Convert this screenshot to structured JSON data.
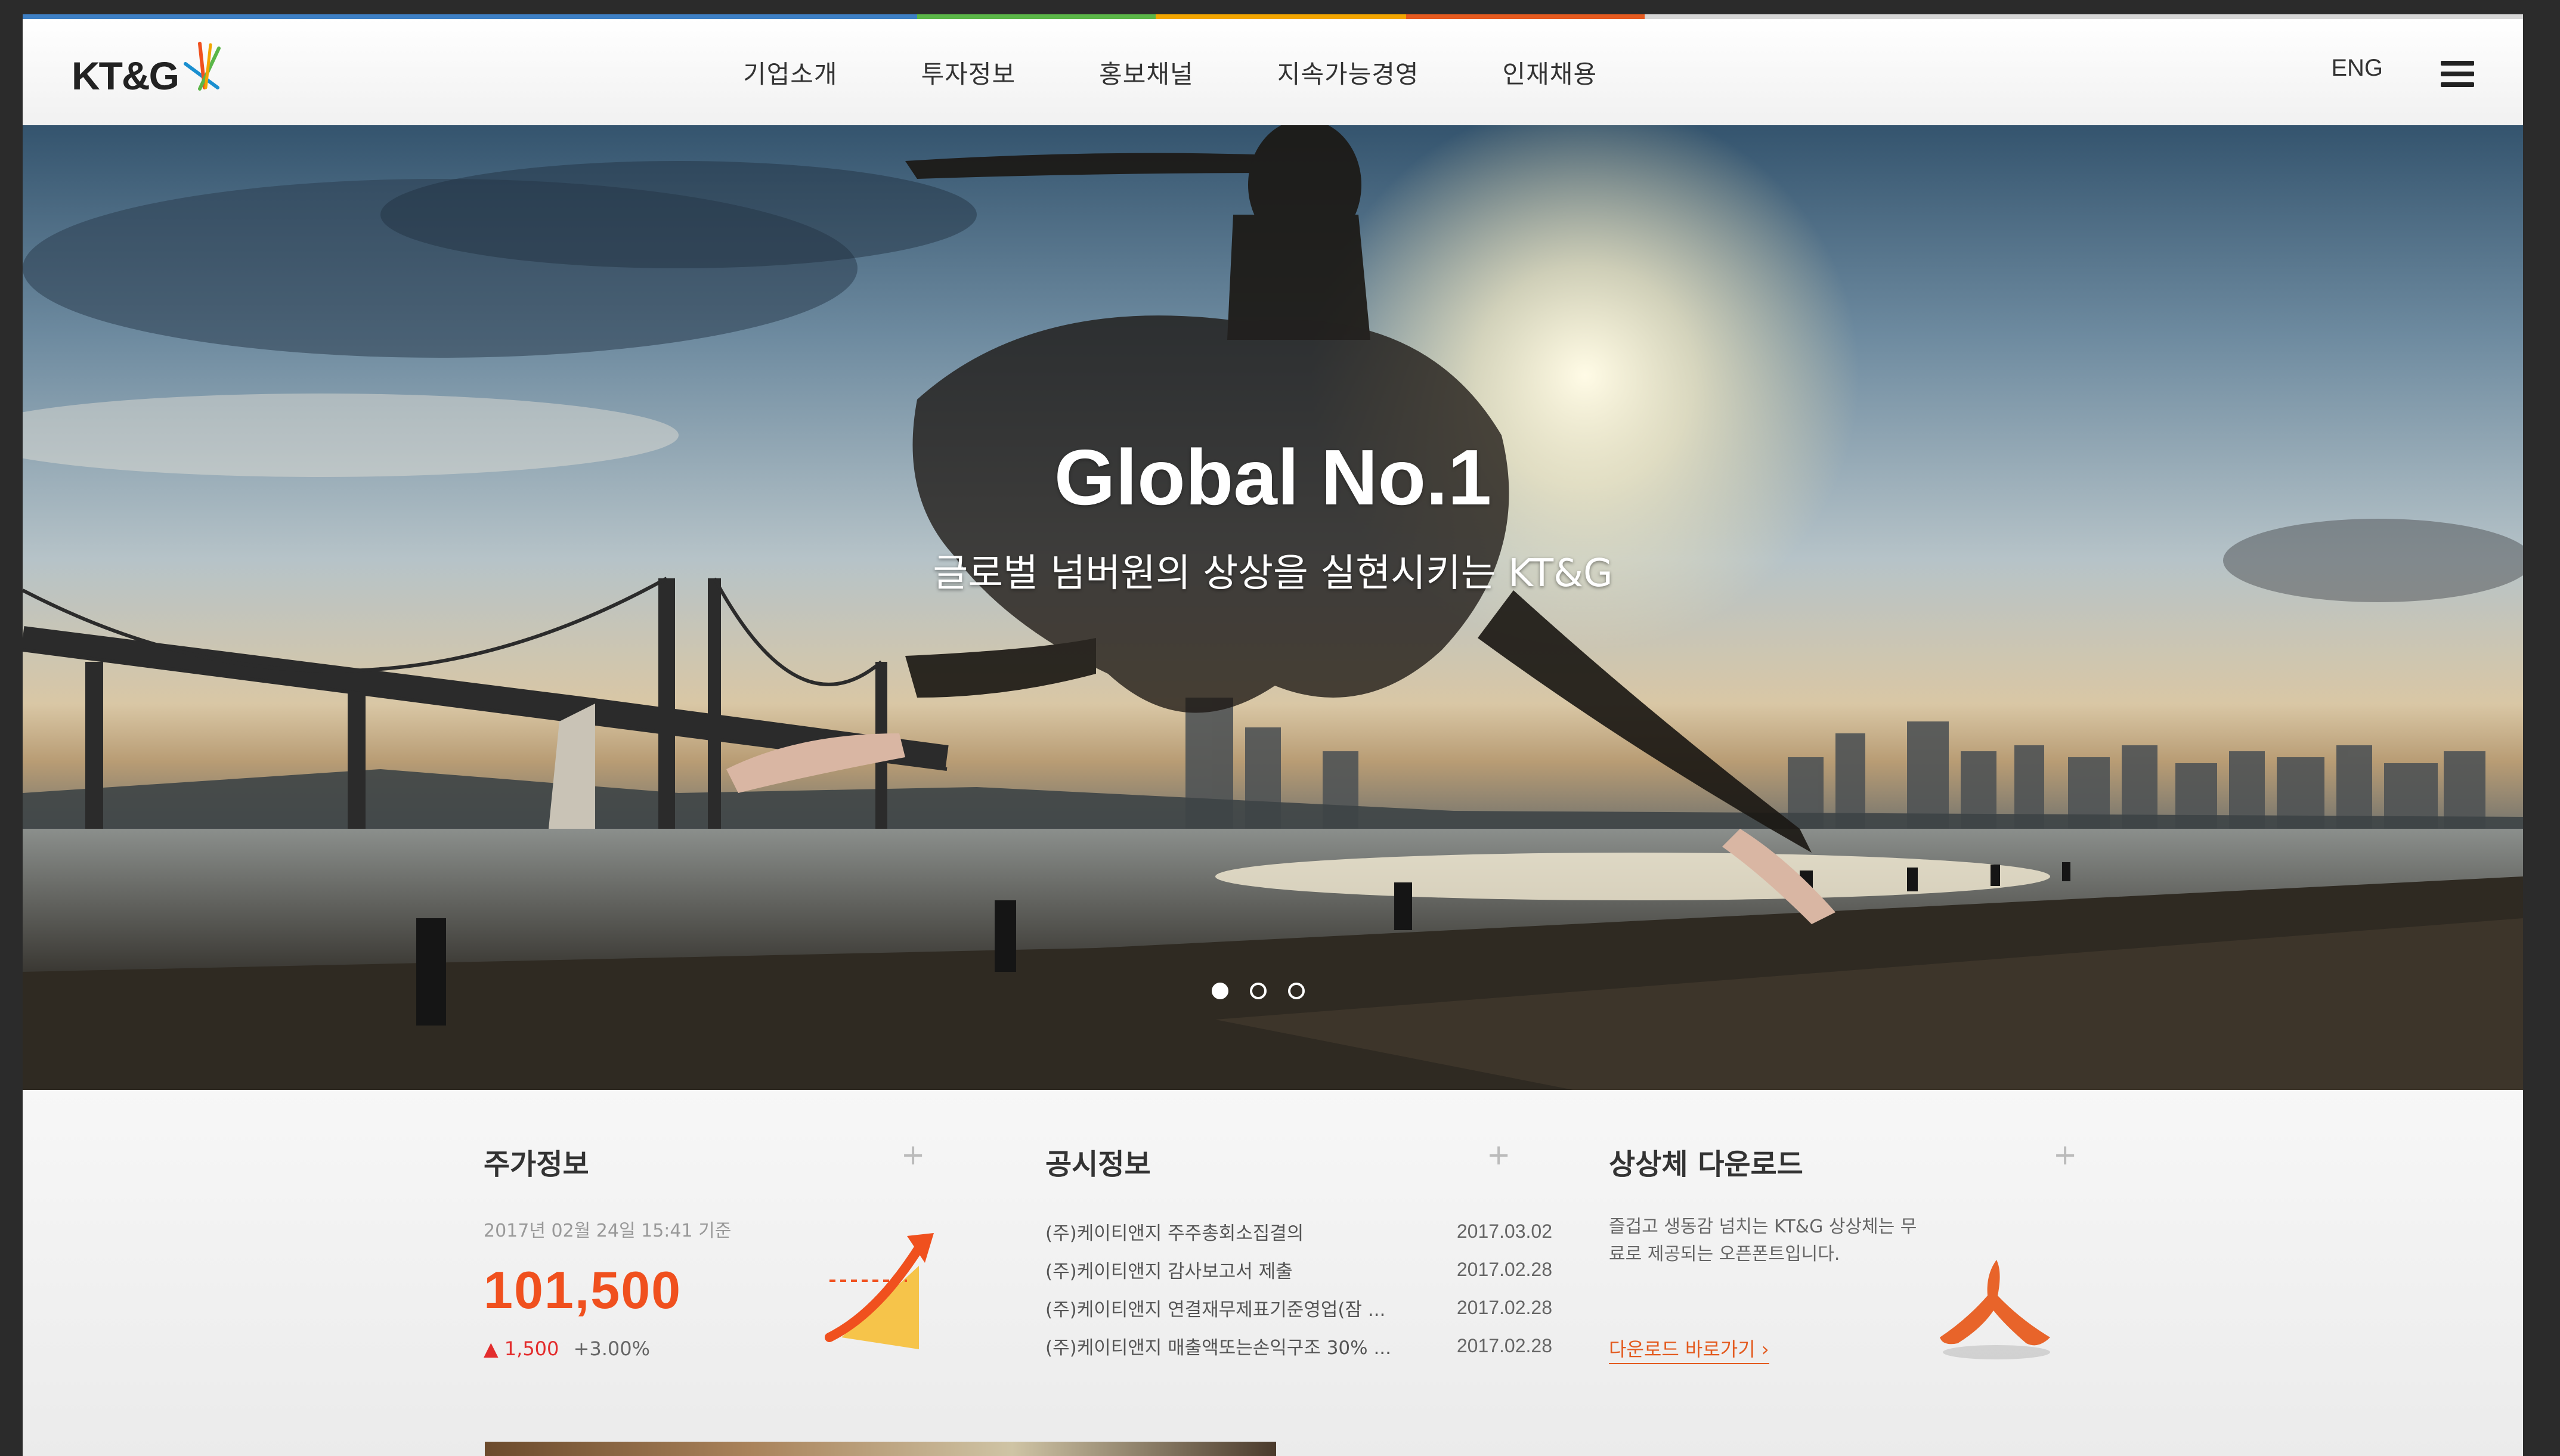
{
  "brand": {
    "logo_text": "KT&G"
  },
  "nav": {
    "items": [
      "기업소개",
      "투자정보",
      "홍보채널",
      "지속가능경영",
      "인재채용"
    ],
    "lang": "ENG"
  },
  "hero": {
    "title": "Global No.1",
    "subtitle": "글로벌 넘버원의 상상을 실현시키는 KT&G",
    "slides": 3,
    "active_slide": 1
  },
  "stock": {
    "title": "주가정보",
    "date": "2017년 02월 24일 15:41 기준",
    "price": "101,500",
    "change": "1,500",
    "change_pct": "+3.00%"
  },
  "notice": {
    "title": "공시정보",
    "items": [
      {
        "title": "(주)케이티앤지 주주총회소집결의",
        "date": "2017.03.02"
      },
      {
        "title": "(주)케이티앤지 감사보고서 제출",
        "date": "2017.02.28"
      },
      {
        "title": "(주)케이티앤지 연결재무제표기준영업(잠 ...",
        "date": "2017.02.28"
      },
      {
        "title": "(주)케이티앤지 매출액또는손익구조 30% ...",
        "date": "2017.02.28"
      }
    ]
  },
  "font_download": {
    "title": "상상체 다운로드",
    "description": "즐겁고 생동감 넘치는 KT&G 상상체는 무료로 제공되는 오픈폰트입니다.",
    "link": "다운로드 바로가기"
  },
  "colors": {
    "accent": "#f0501e",
    "up": "#e32d2d"
  },
  "icons": {
    "menu": "hamburger-icon",
    "more": "plus-icon",
    "link": "chevron-right-icon"
  }
}
